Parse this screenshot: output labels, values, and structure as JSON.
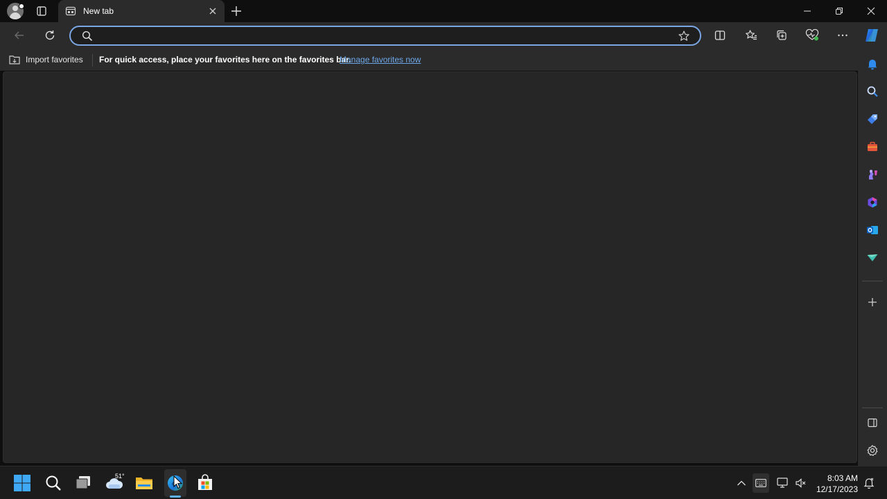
{
  "browser": {
    "tab_title": "New tab",
    "address_value": "",
    "accent_color": "#7aa7e4"
  },
  "favorites_bar": {
    "import_label": "Import favorites",
    "message": "For quick access, place your favorites here on the favorites bar.",
    "link_label": "Manage favorites now"
  },
  "sidebar": {
    "items": [
      "notifications-icon",
      "search-icon",
      "shopping-icon",
      "tools-icon",
      "games-icon",
      "microsoft-365-icon",
      "outlook-icon",
      "drop-icon",
      "add-icon"
    ],
    "bottom": [
      "hide-sidebar-icon",
      "settings-icon"
    ]
  },
  "taskbar": {
    "weather_temp": "51°",
    "time": "8:03 AM",
    "date": "12/17/2023",
    "pinned": [
      "start-icon",
      "search-icon",
      "task-view-icon",
      "weather-icon",
      "file-explorer-icon",
      "edge-icon",
      "store-icon"
    ]
  }
}
